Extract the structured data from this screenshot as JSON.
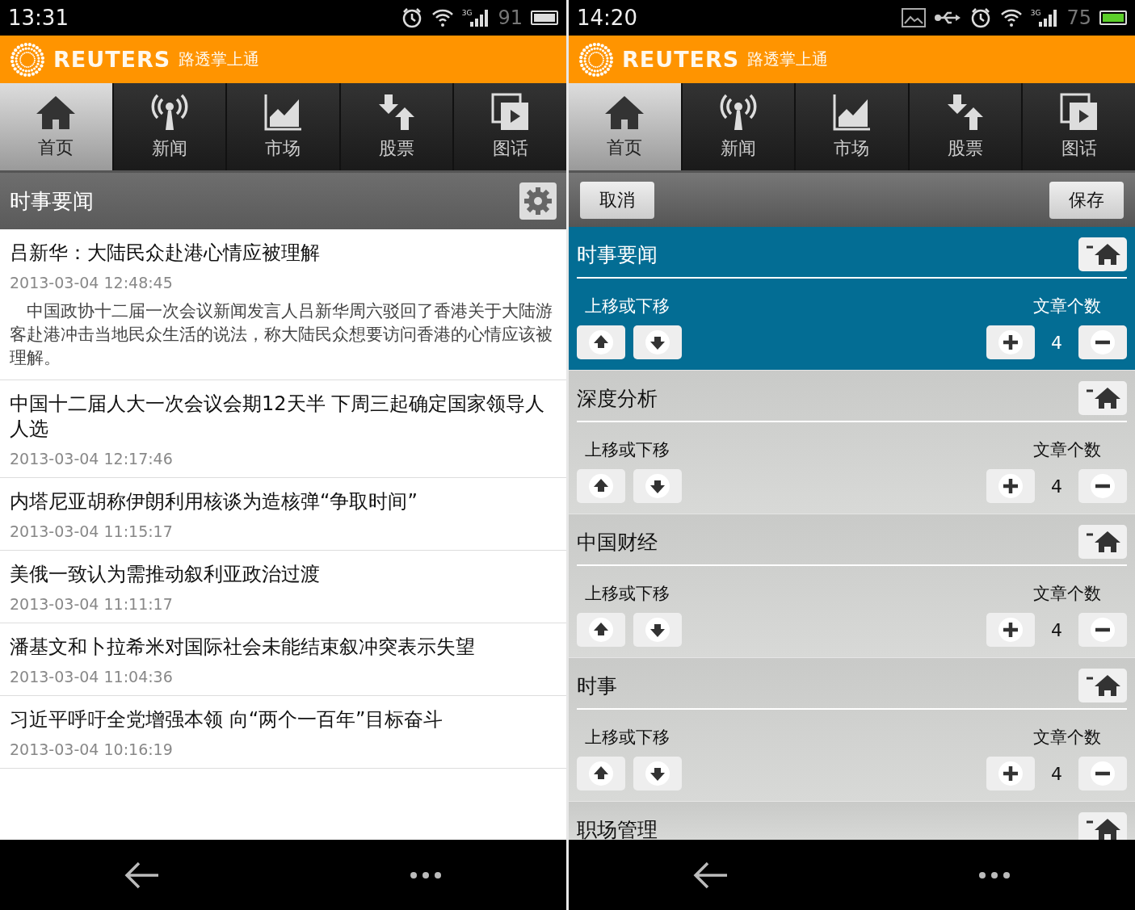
{
  "phones": [
    {
      "kind": "news_list",
      "status_bar": {
        "time": "13:31",
        "icons": [
          {
            "kind": "alarm"
          },
          {
            "kind": "wifi"
          },
          {
            "kind": "signal"
          }
        ],
        "network": "3G",
        "battery": "91",
        "charging": false
      },
      "header": {
        "brand": "REUTERS",
        "subtitle": "路透掌上通"
      },
      "tabs": [
        {
          "label": "首页",
          "selected": true
        },
        {
          "label": "新闻",
          "selected": false
        },
        {
          "label": "市场",
          "selected": false
        },
        {
          "label": "股票",
          "selected": false
        },
        {
          "label": "图话",
          "selected": false
        }
      ],
      "section_title": "时事要闻",
      "articles": [
        {
          "title": "吕新华：大陆民众赴港心情应被理解",
          "time": "2013-03-04 12:48:45",
          "summary": "中国政协十二届一次会议新闻发言人吕新华周六驳回了香港关于大陆游客赴港冲击当地民众生活的说法，称大陆民众想要访问香港的心情应该被理解。"
        },
        {
          "title": "中国十二届人大一次会议会期12天半 下周三起确定国家领导人人选",
          "time": "2013-03-04 12:17:46"
        },
        {
          "title": "内塔尼亚胡称伊朗利用核谈为造核弹“争取时间”",
          "time": "2013-03-04 11:15:17"
        },
        {
          "title": "美俄一致认为需推动叙利亚政治过渡",
          "time": "2013-03-04 11:11:17"
        },
        {
          "title": "潘基文和卜拉希米对国际社会未能结束叙冲突表示失望",
          "time": "2013-03-04 11:04:36"
        },
        {
          "title": "习近平呼吁全党增强本领 向“两个一百年”目标奋斗",
          "time": "2013-03-04 10:16:19"
        }
      ]
    },
    {
      "kind": "settings",
      "status_bar": {
        "time": "14:20",
        "icons": [
          {
            "kind": "image"
          },
          {
            "kind": "usb"
          },
          {
            "kind": "alarm"
          },
          {
            "kind": "wifi"
          },
          {
            "kind": "signal"
          }
        ],
        "network": "3G",
        "battery": "75",
        "charging": true
      },
      "header": {
        "brand": "REUTERS",
        "subtitle": "路透掌上通"
      },
      "tabs": [
        {
          "label": "首页",
          "selected": true
        },
        {
          "label": "新闻",
          "selected": false
        },
        {
          "label": "市场",
          "selected": false
        },
        {
          "label": "股票",
          "selected": false
        },
        {
          "label": "图话",
          "selected": false
        }
      ],
      "cancel": "取消",
      "save": "保存",
      "sections": [
        {
          "title": "时事要闻",
          "selected": true,
          "move_label": "上移或下移",
          "count_label": "文章个数",
          "count": "4"
        },
        {
          "title": "深度分析",
          "selected": false,
          "move_label": "上移或下移",
          "count_label": "文章个数",
          "count": "4"
        },
        {
          "title": "中国财经",
          "selected": false,
          "move_label": "上移或下移",
          "count_label": "文章个数",
          "count": "4"
        },
        {
          "title": "时事",
          "selected": false,
          "move_label": "上移或下移",
          "count_label": "文章个数",
          "count": "4"
        },
        {
          "title": "职场管理",
          "selected": false
        }
      ]
    }
  ]
}
